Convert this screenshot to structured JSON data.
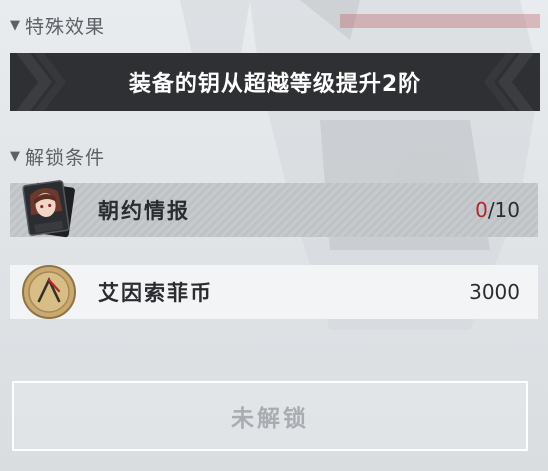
{
  "special_effect": {
    "heading": "特殊效果",
    "text": "装备的钥从超越等级提升2阶"
  },
  "unlock_conditions": {
    "heading": "解锁条件",
    "items": [
      {
        "label": "朝约情报",
        "current": "0",
        "required": "/10",
        "icon": "character-portrait-icon"
      },
      {
        "label": "艾因索菲币",
        "amount": "3000",
        "icon": "gold-coin-icon"
      }
    ]
  },
  "action": {
    "unlock_label": "未解锁"
  },
  "colors": {
    "banner": "#2f3033",
    "insufficient": "#b3262c",
    "disabled_text": "#a9acb0"
  }
}
